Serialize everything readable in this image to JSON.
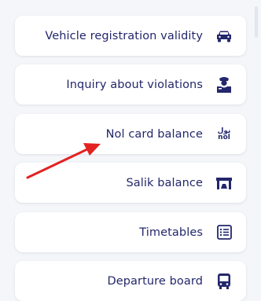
{
  "services": [
    {
      "label": "Vehicle registration validity",
      "icon": "car-icon"
    },
    {
      "label": "Inquiry about violations",
      "icon": "officer-icon"
    },
    {
      "label": "Nol card balance",
      "icon": "nol-logo-icon",
      "icon_text_ar": "نول",
      "icon_text_en": "nol"
    },
    {
      "label": "Salik balance",
      "icon": "salik-gate-icon"
    },
    {
      "label": "Timetables",
      "icon": "timetable-list-icon"
    },
    {
      "label": "Departure board",
      "icon": "bus-icon"
    }
  ],
  "colors": {
    "text": "#23276b",
    "card": "#ffffff",
    "background": "#f4f6f9",
    "annotation_arrow": "#e32222"
  }
}
